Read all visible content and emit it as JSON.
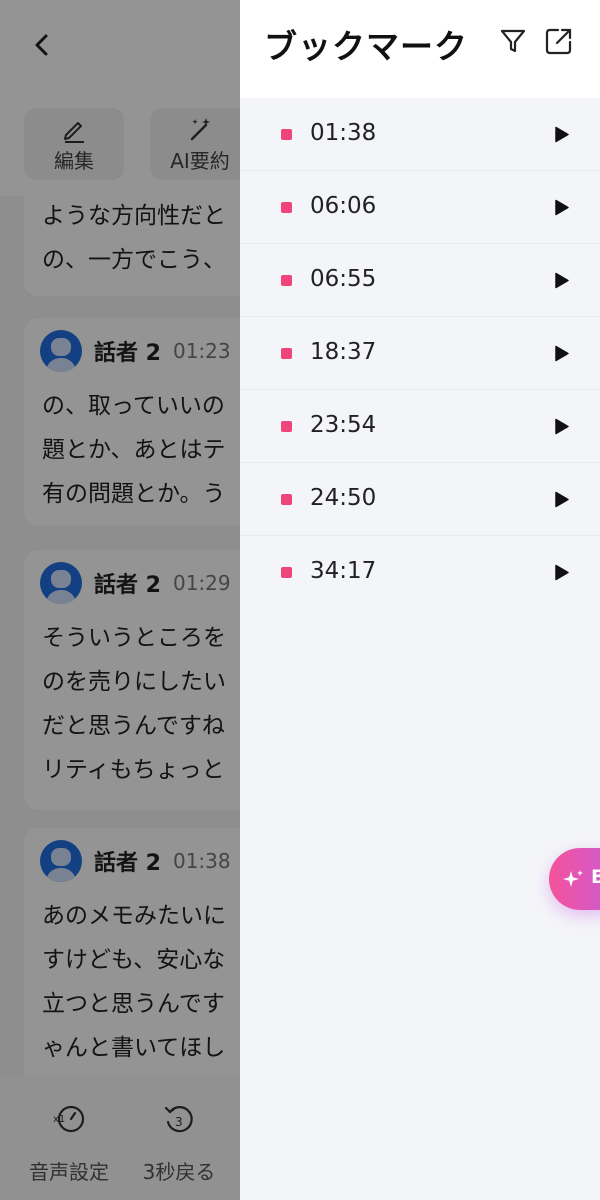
{
  "background": {
    "toolbar": [
      {
        "label": "編集",
        "icon": "pen-icon"
      },
      {
        "label": "AI要約",
        "icon": "magic-wand-icon"
      }
    ],
    "cards": [
      {
        "lines": [
          "ような方向性だと",
          "の、一方でこう、"
        ]
      },
      {
        "speaker": "話者 2",
        "time": "01:23",
        "lines": [
          "の、取っていいの",
          "題とか、あとはテ",
          "有の問題とか。う"
        ]
      },
      {
        "speaker": "話者 2",
        "time": "01:29",
        "lines": [
          "そういうところを",
          "のを売りにしたい",
          "だと思うんですね",
          "リティもちょっと"
        ]
      },
      {
        "speaker": "話者 2",
        "time": "01:38",
        "lines": [
          "あのメモみたいに",
          "すけども、安心な",
          "立つと思うんです",
          "ゃんと書いてほし"
        ]
      }
    ],
    "bottom_bar": [
      {
        "label": "音声設定",
        "icon": "playback-speed-icon"
      },
      {
        "label": "3秒戻る",
        "icon": "rewind-3s-icon"
      }
    ]
  },
  "drawer": {
    "title": "ブックマーク",
    "filter_icon": "filter-icon",
    "export_icon": "export-icon",
    "bookmarks": [
      {
        "time": "01:38"
      },
      {
        "time": "06:06"
      },
      {
        "time": "06:55"
      },
      {
        "time": "18:37"
      },
      {
        "time": "23:54"
      },
      {
        "time": "24:50"
      },
      {
        "time": "34:17"
      }
    ],
    "accent_color": "#f0457a"
  },
  "fab": {
    "label": "B",
    "icon": "sparkle-icon"
  }
}
